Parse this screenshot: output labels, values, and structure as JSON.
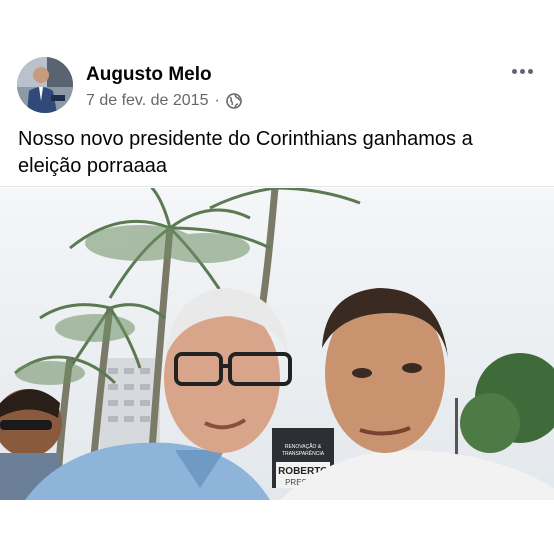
{
  "post": {
    "author_name": "Augusto Melo",
    "date": "7 de fev. de 2015",
    "separator": "·",
    "privacy_icon": "globe-icon",
    "menu_icon": "more-options-icon",
    "text": "Nosso novo presidente do Corinthians ganhamos a eleição porraaaa"
  },
  "photo": {
    "sign_line1": "RENOVAÇÃO &",
    "sign_line2": "TRANSPARÊNCIA",
    "sign_name": "ROBERTO",
    "sign_role": "PRESID"
  }
}
